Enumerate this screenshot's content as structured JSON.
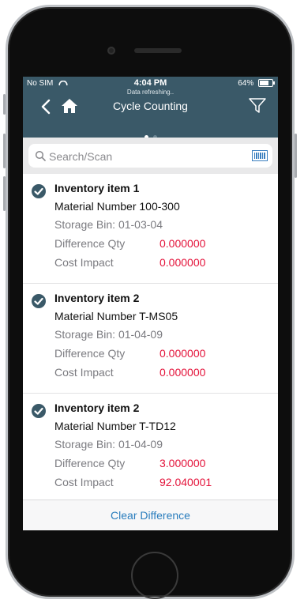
{
  "status_bar": {
    "carrier": "No SIM",
    "time": "4:04 PM",
    "battery": "64%"
  },
  "header": {
    "subtitle": "Data refreshing..",
    "title": "Cycle Counting"
  },
  "search": {
    "placeholder": "Search/Scan"
  },
  "items": [
    {
      "title": "Inventory item 1",
      "material": "Material Number 100-300",
      "bin": "Storage Bin: 01-03-04",
      "diff_label": "Difference Qty",
      "diff_value": "0.000000",
      "cost_label": "Cost Impact",
      "cost_value": "0.000000"
    },
    {
      "title": "Inventory item 2",
      "material": "Material Number T-MS05",
      "bin": "Storage Bin: 01-04-09",
      "diff_label": "Difference Qty",
      "diff_value": "0.000000",
      "cost_label": "Cost Impact",
      "cost_value": "0.000000"
    },
    {
      "title": "Inventory item 2",
      "material": "Material Number T-TD12",
      "bin": "Storage Bin: 01-04-09",
      "diff_label": "Difference Qty",
      "diff_value": "3.000000",
      "cost_label": "Cost Impact",
      "cost_value": "92.040001"
    }
  ],
  "footer": {
    "action_label": "Clear Difference"
  },
  "colors": {
    "header_bg": "#3a5968",
    "value_red": "#e4133a",
    "link_blue": "#2a7dbd"
  },
  "icons": [
    "back-chevron-icon",
    "home-icon",
    "filter-icon",
    "search-icon",
    "barcode-icon",
    "checkmark-circle-icon",
    "wifi-icon",
    "battery-icon"
  ]
}
